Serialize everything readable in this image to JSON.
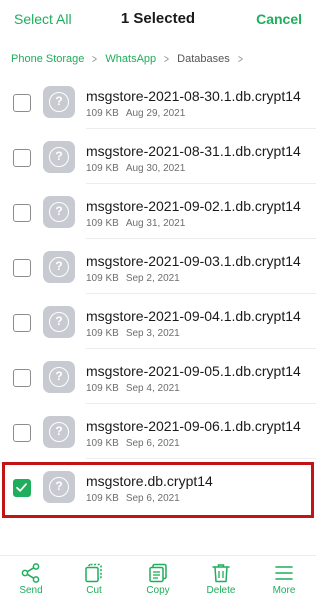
{
  "header": {
    "select_all": "Select All",
    "title": "1 Selected",
    "cancel": "Cancel"
  },
  "breadcrumb": {
    "items": [
      "Phone Storage",
      "WhatsApp",
      "Databases"
    ],
    "separator": ">"
  },
  "files": [
    {
      "name": "msgstore-2021-08-30.1.db.crypt14",
      "size": "109 KB",
      "date": "Aug 29, 2021",
      "checked": false
    },
    {
      "name": "msgstore-2021-08-31.1.db.crypt14",
      "size": "109 KB",
      "date": "Aug 30, 2021",
      "checked": false
    },
    {
      "name": "msgstore-2021-09-02.1.db.crypt14",
      "size": "109 KB",
      "date": "Aug 31, 2021",
      "checked": false
    },
    {
      "name": "msgstore-2021-09-03.1.db.crypt14",
      "size": "109 KB",
      "date": "Sep 2, 2021",
      "checked": false
    },
    {
      "name": "msgstore-2021-09-04.1.db.crypt14",
      "size": "109 KB",
      "date": "Sep 3, 2021",
      "checked": false
    },
    {
      "name": "msgstore-2021-09-05.1.db.crypt14",
      "size": "109 KB",
      "date": "Sep 4, 2021",
      "checked": false
    },
    {
      "name": "msgstore-2021-09-06.1.db.crypt14",
      "size": "109 KB",
      "date": "Sep 6, 2021",
      "checked": false
    },
    {
      "name": "msgstore.db.crypt14",
      "size": "109 KB",
      "date": "Sep 6, 2021",
      "checked": true
    }
  ],
  "file_icon": {
    "name": "unknown-file-icon",
    "glyph": "?"
  },
  "toolbar": {
    "items": [
      {
        "label": "Send",
        "icon": "share-icon"
      },
      {
        "label": "Cut",
        "icon": "cut-icon"
      },
      {
        "label": "Copy",
        "icon": "copy-icon"
      },
      {
        "label": "Delete",
        "icon": "trash-icon"
      },
      {
        "label": "More",
        "icon": "menu-icon"
      }
    ]
  },
  "colors": {
    "accent": "#1fae5b",
    "highlight": "#c21414",
    "icon_bg": "#c7cbd1"
  }
}
